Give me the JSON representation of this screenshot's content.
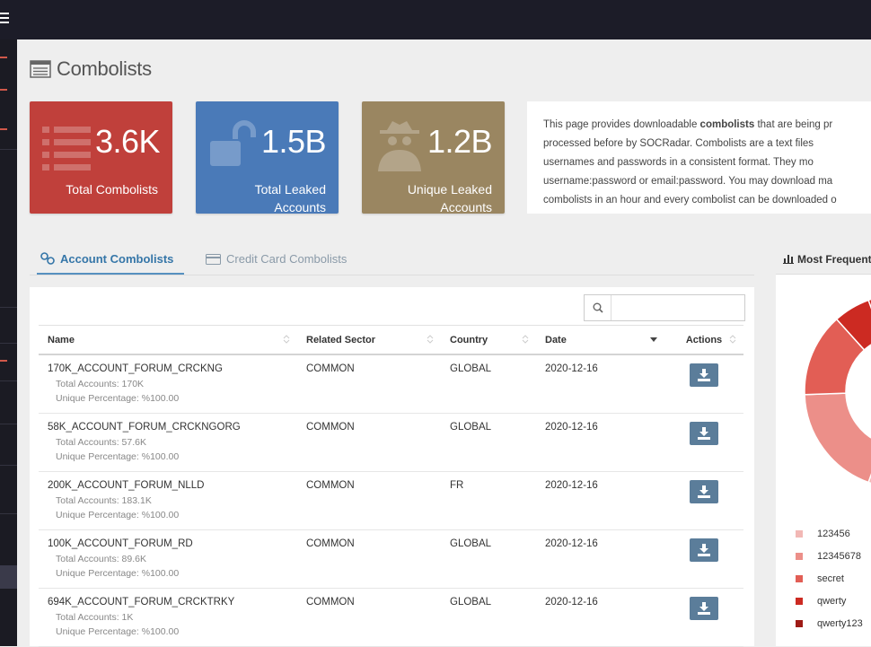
{
  "page": {
    "title": "Combolists"
  },
  "stats": [
    {
      "value": "3.6K",
      "label_line1": "Total Combolists",
      "label_line2": "",
      "color": "#c0403b"
    },
    {
      "value": "1.5B",
      "label_line1": "Total Leaked",
      "label_line2": "Accounts",
      "color": "#4a7ab8"
    },
    {
      "value": "1.2B",
      "label_line1": "Unique Leaked",
      "label_line2": "Accounts",
      "color": "#9a8661"
    }
  ],
  "info": {
    "line1_pre": "This page provides downloadable ",
    "line1_bold": "combolists",
    "line1_post": " that are being pr",
    "line2": "processed before by SOCRadar. Combolists are a text files",
    "line3": "usernames and passwords in a consistent format. They mo",
    "line4": "username:password or email:password. You may download ma",
    "line5": "combolists in an hour and every combolist can be downloaded o"
  },
  "tabs": {
    "account": "Account Combolists",
    "credit_card": "Credit Card Combolists"
  },
  "table": {
    "search_value": "",
    "columns": [
      "Name",
      "Related Sector",
      "Country",
      "Date",
      "Actions"
    ],
    "rows": [
      {
        "name": "170K_ACCOUNT_FORUM_CRCKNG",
        "total": "Total Accounts: 170K",
        "unique": "Unique Percentage: %100.00",
        "sector": "COMMON",
        "country": "GLOBAL",
        "date": "2020-12-16"
      },
      {
        "name": "58K_ACCOUNT_FORUM_CRCKNGORG",
        "total": "Total Accounts: 57.6K",
        "unique": "Unique Percentage: %100.00",
        "sector": "COMMON",
        "country": "GLOBAL",
        "date": "2020-12-16"
      },
      {
        "name": "200K_ACCOUNT_FORUM_NLLD",
        "total": "Total Accounts: 183.1K",
        "unique": "Unique Percentage: %100.00",
        "sector": "COMMON",
        "country": "FR",
        "date": "2020-12-16"
      },
      {
        "name": "100K_ACCOUNT_FORUM_RD",
        "total": "Total Accounts: 89.6K",
        "unique": "Unique Percentage: %100.00",
        "sector": "COMMON",
        "country": "GLOBAL",
        "date": "2020-12-16"
      },
      {
        "name": "694K_ACCOUNT_FORUM_CRCKTRKY",
        "total": "Total Accounts: 1K",
        "unique": "Unique Percentage: %100.00",
        "sector": "COMMON",
        "country": "GLOBAL",
        "date": "2020-12-16"
      }
    ]
  },
  "chart": {
    "title": "Most Frequent",
    "legend": [
      {
        "label": "123456",
        "color": "#f2b8b5"
      },
      {
        "label": "12345678",
        "color": "#ec8f89"
      },
      {
        "label": "secret",
        "color": "#e25e55"
      },
      {
        "label": "qwerty",
        "color": "#cc2a22"
      },
      {
        "label": "qwerty123",
        "color": "#9e1b15"
      }
    ]
  }
}
